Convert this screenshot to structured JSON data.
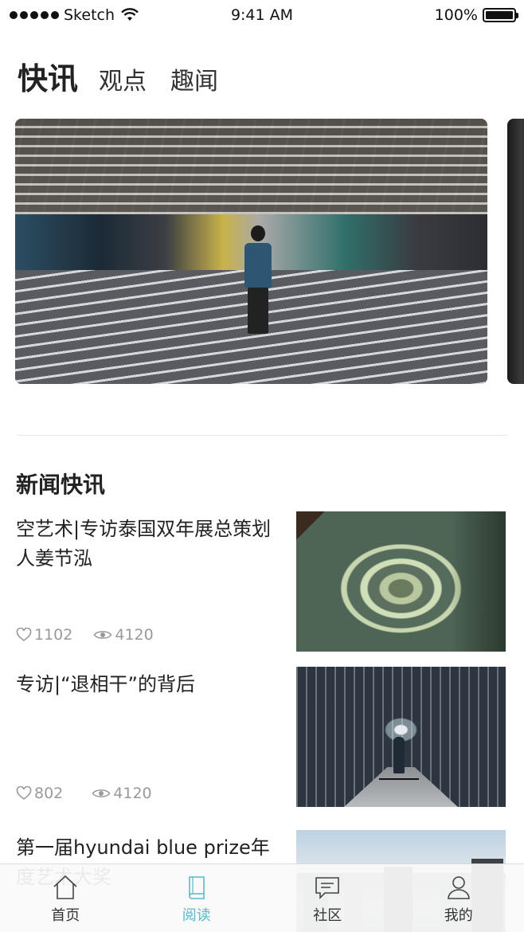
{
  "status_bar": {
    "carrier": "Sketch",
    "time": "9:41 AM",
    "battery": "100%"
  },
  "top_tabs": [
    {
      "label": "快讯",
      "active": true
    },
    {
      "label": "观点",
      "active": false
    },
    {
      "label": "趣闻",
      "active": false
    }
  ],
  "section": {
    "title": "新闻快讯"
  },
  "news": [
    {
      "title": "空艺术|专访泰国双年展总策划人姜节泓",
      "likes": "1102",
      "views": "4120"
    },
    {
      "title": "专访|“退相干”的背后",
      "likes": "802",
      "views": "4120"
    },
    {
      "title": "第一届hyundai blue prize年度艺术大奖",
      "likes": "",
      "views": ""
    }
  ],
  "tab_bar": {
    "items": [
      {
        "label": "首页",
        "icon": "home-icon",
        "active": false
      },
      {
        "label": "阅读",
        "icon": "book-icon",
        "active": true
      },
      {
        "label": "社区",
        "icon": "chat-icon",
        "active": false
      },
      {
        "label": "我的",
        "icon": "user-icon",
        "active": false
      }
    ],
    "active_color": "#5bb8c8"
  }
}
